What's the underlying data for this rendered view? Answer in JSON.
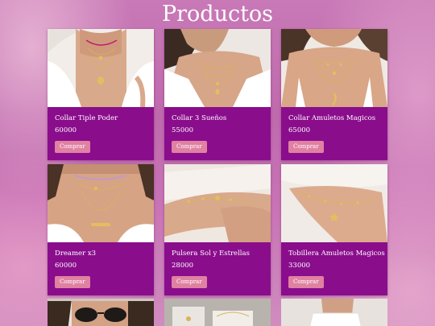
{
  "page": {
    "title": "Productos"
  },
  "products": [
    {
      "name": "Collar Tiple Poder",
      "price": "60000",
      "button": "Comprar",
      "image": "necklace-layered-coin-photo"
    },
    {
      "name": "Collar 3 Sueños",
      "price": "55000",
      "button": "Comprar",
      "image": "necklace-three-layer-photo"
    },
    {
      "name": "Collar Amuletos Magicos",
      "price": "65000",
      "button": "Comprar",
      "image": "necklace-amulets-horn-photo"
    },
    {
      "name": "Dreamer x3",
      "price": "60000",
      "button": "Comprar",
      "image": "necklace-dreamer-choker-photo"
    },
    {
      "name": "Pulsera Sol y Estrellas",
      "price": "28000",
      "button": "Comprar",
      "image": "bracelet-sun-stars-photo"
    },
    {
      "name": "Tobillera Amuletos Magicos",
      "price": "33000",
      "button": "Comprar",
      "image": "anklet-amulets-photo"
    }
  ],
  "partial_products": [
    {
      "image": "woman-sunglasses-photo"
    },
    {
      "image": "jewelry-flatlay-photo"
    },
    {
      "image": "woman-white-top-photo"
    }
  ],
  "colors": {
    "card_background": "#8a0d8c",
    "button_background": "#e081a2",
    "page_background": "#c46fb2",
    "text": "#ffffff"
  }
}
